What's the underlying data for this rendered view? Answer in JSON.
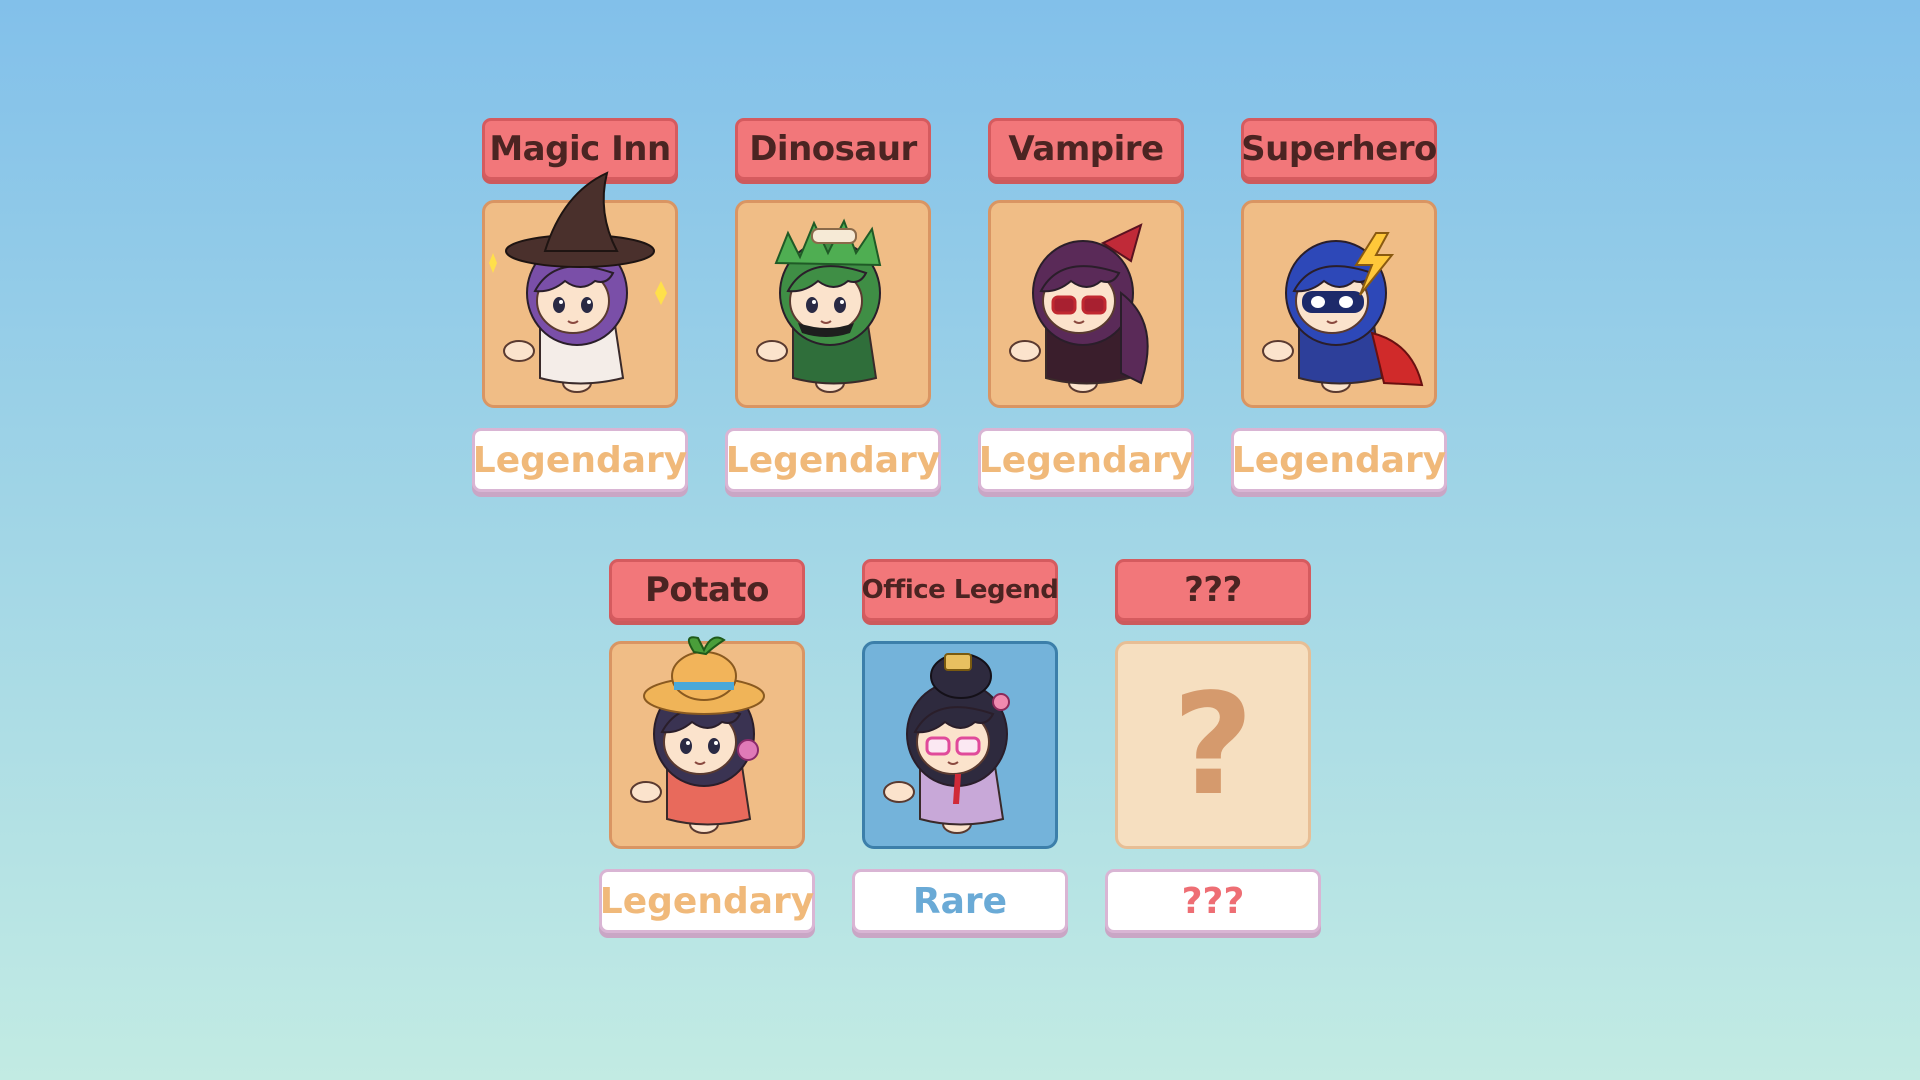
{
  "colors": {
    "legendary": "#f0b97a",
    "rare": "#6aaad6",
    "unknown": "#ee6e74",
    "title_bg": "#f2777a",
    "title_text": "#4b2422"
  },
  "costumes": [
    {
      "name": "Magic Inn",
      "rarity": "Legendary",
      "rarity_color": "#f0b97a",
      "icon": "witch-character-icon",
      "hair": "#7a4fa8",
      "hat": "#4a302c",
      "outfit": "#f4ede8"
    },
    {
      "name": "Dinosaur",
      "rarity": "Legendary",
      "rarity_color": "#f0b97a",
      "icon": "dinosaur-character-icon",
      "hair": "#3f8e45",
      "hat": "#3f8e45",
      "outfit": "#2f6e3a"
    },
    {
      "name": "Vampire",
      "rarity": "Legendary",
      "rarity_color": "#f0b97a",
      "icon": "vampire-character-icon",
      "hair": "#5a2a58",
      "hat": "#5a2a58",
      "outfit": "#3a1e2c"
    },
    {
      "name": "Superhero",
      "rarity": "Legendary",
      "rarity_color": "#f0b97a",
      "icon": "superhero-character-icon",
      "hair": "#2d48b8",
      "hat": "#2d48b8",
      "outfit": "#2d3f9a"
    },
    {
      "name": "Potato",
      "rarity": "Legendary",
      "rarity_color": "#f0b97a",
      "icon": "potato-character-icon",
      "hair": "#3a3352",
      "hat": "#f2b45a",
      "outfit": "#e86a5c"
    },
    {
      "name": "Office Legend",
      "rarity": "Rare",
      "rarity_color": "#6aaad6",
      "icon": "office-character-icon",
      "hair": "#2e2a3e",
      "hat": "#2e2a3e",
      "outfit": "#c8a8d8"
    },
    {
      "name": "???",
      "rarity": "???",
      "rarity_color": "#ee6e74",
      "icon": "question-mark-icon",
      "locked_symbol": "?"
    }
  ]
}
